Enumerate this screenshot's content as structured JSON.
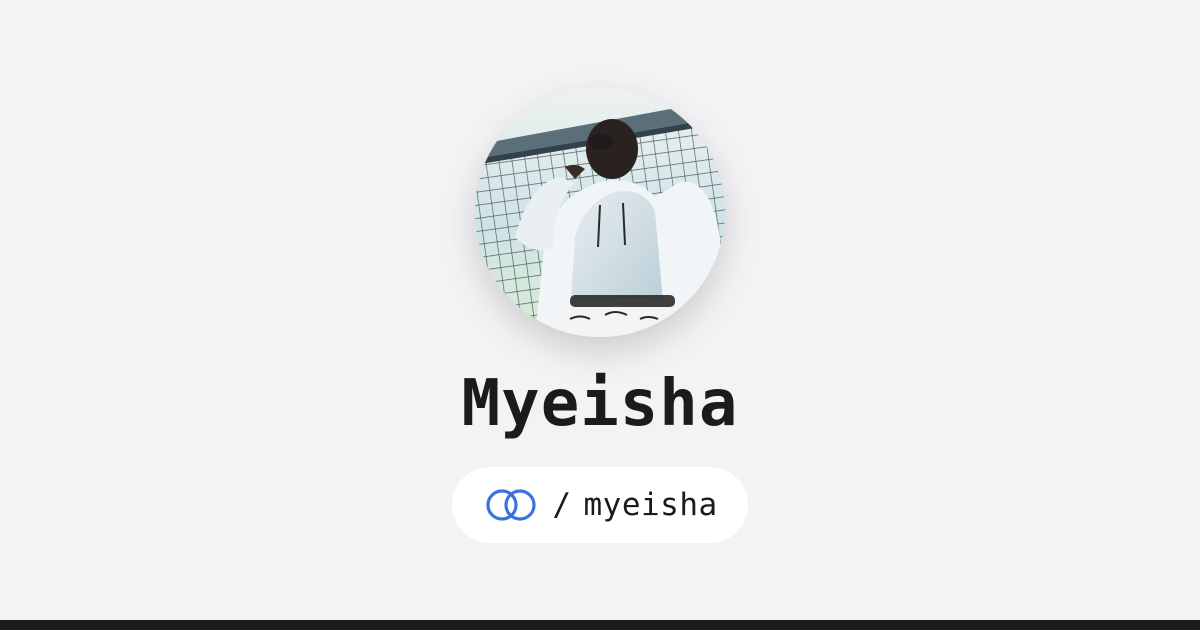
{
  "profile": {
    "display_name": "Myeisha",
    "handle_separator": "/",
    "handle": "myeisha",
    "avatar_icon": "profile-photo",
    "logo_icon": "interlocking-rings-icon"
  },
  "colors": {
    "background": "#f3f3f5",
    "pill_background": "#ffffff",
    "text": "#1b1b1d",
    "brand_blue": "#3a73e0",
    "bottom_bar": "#1c1c1e"
  }
}
